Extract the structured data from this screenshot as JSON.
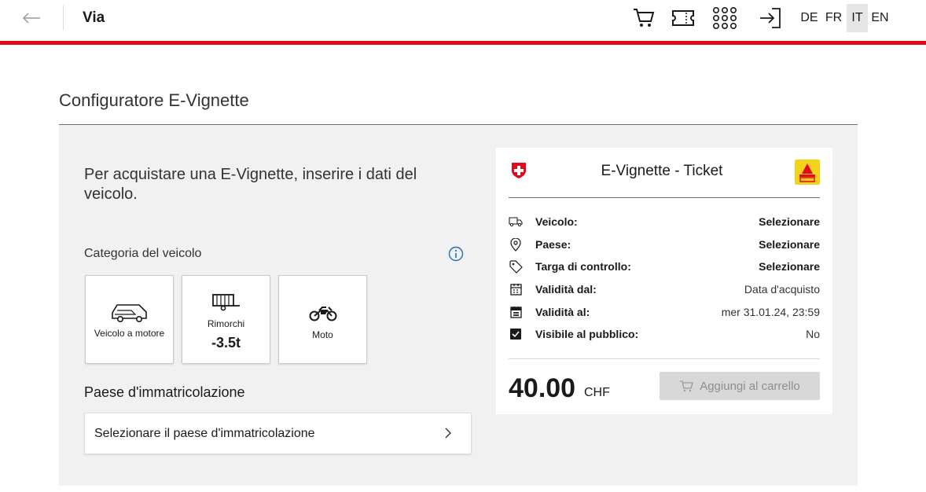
{
  "header": {
    "title": "Via",
    "icons": [
      "arrow-left-icon",
      "cart-icon",
      "ticket-icon",
      "grid-icon",
      "login-icon"
    ],
    "languages": [
      "DE",
      "FR",
      "IT",
      "EN"
    ],
    "active_language": "IT",
    "accent_color": "#e4081d"
  },
  "page": {
    "title": "Configuratore E-Vignette",
    "intro": "Per acquistare una E-Vignette, inserire i dati del veicolo.",
    "vehicle_category_label": "Categoria del veicolo",
    "categories": [
      {
        "label": "Veicolo a motore",
        "icon": "car-icon"
      },
      {
        "label": "Rimorchi",
        "sub": "-3.5t",
        "icon": "trailer-icon"
      },
      {
        "label": "Moto",
        "icon": "motorcycle-icon"
      }
    ],
    "country_label": "Paese d'immatricolazione",
    "country_select_placeholder": "Selezionare il paese d'immatricolazione"
  },
  "ticket": {
    "title": "E-Vignette - Ticket",
    "rows": [
      {
        "label": "Veicolo:",
        "value": "Selezionare",
        "icon": "truck-icon"
      },
      {
        "label": "Paese:",
        "value": "Selezionare",
        "icon": "location-pin-icon"
      },
      {
        "label": "Targa di controllo:",
        "value": "Selezionare",
        "icon": "tag-icon"
      },
      {
        "label": "Validità dal:",
        "value": "Data d'acquisto",
        "icon": "calendar-icon"
      },
      {
        "label": "Validità al:",
        "value": "mer 31.01.24, 23:59",
        "icon": "calendar-filled-icon"
      },
      {
        "label": "Visibile al pubblico:",
        "value": "No",
        "icon": "checkbox-icon"
      }
    ],
    "price": "40.00",
    "currency": "CHF",
    "add_to_cart_label": "Aggiungi al carrello"
  }
}
